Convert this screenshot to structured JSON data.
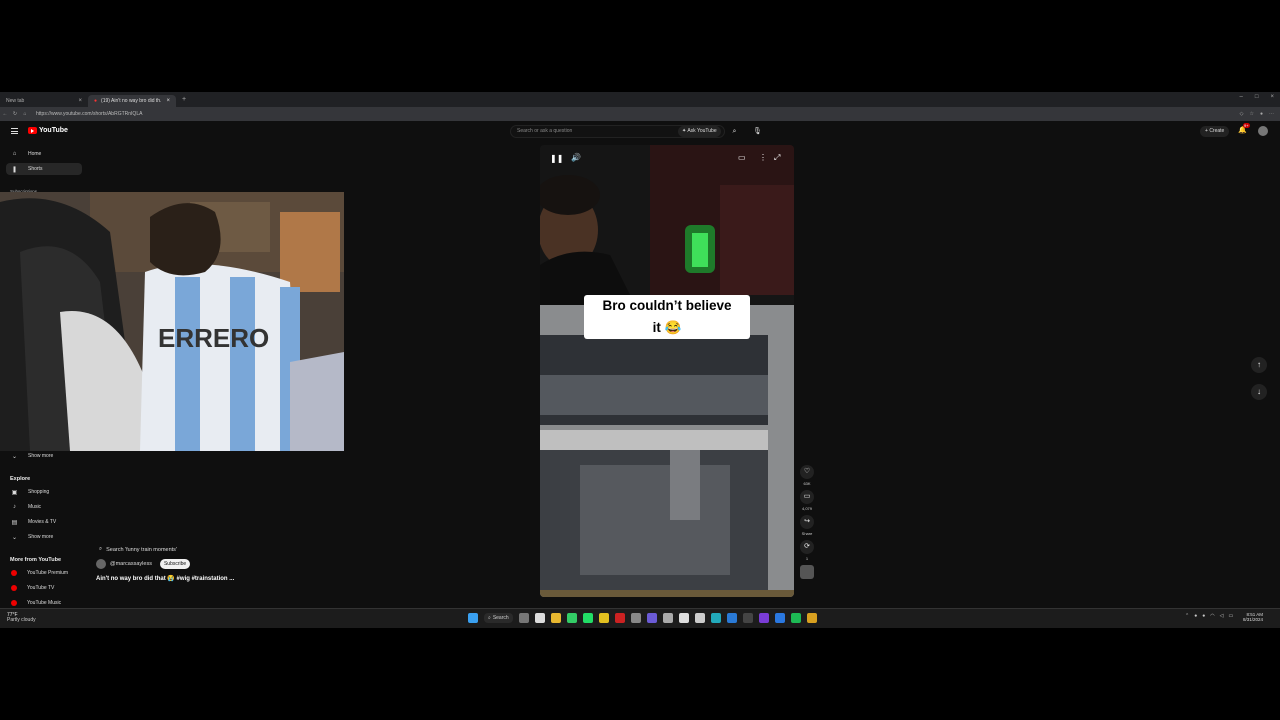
{
  "browser": {
    "tabs": [
      {
        "label": "New tab",
        "active": false
      },
      {
        "label": "(19) Ain't no way bro did th...",
        "active": true
      }
    ],
    "url": "https://www.youtube.com/shorts/AbRGTRnIQLA",
    "new_tab_glyph": "+"
  },
  "header": {
    "logo_text": "YouTube",
    "search_placeholder": "Search or ask a question",
    "ask_label": "Ask YouTube",
    "create_label": "Create",
    "notif_count": "9+"
  },
  "sidebar": {
    "top_items": [
      {
        "label": "Home",
        "icon": "home-icon"
      },
      {
        "label": "Shorts",
        "icon": "shorts-icon",
        "active": true
      }
    ],
    "subscriptions_label": "Subscriptions",
    "show_more_1": "Show more",
    "explore_header": "Explore",
    "explore_items": [
      {
        "label": "Shopping",
        "icon": "bag-icon"
      },
      {
        "label": "Music",
        "icon": "music-icon"
      },
      {
        "label": "Movies & TV",
        "icon": "film-icon"
      }
    ],
    "show_more_2": "Show more",
    "more_header": "More from YouTube",
    "more_items": [
      {
        "label": "YouTube Premium"
      },
      {
        "label": "YouTube TV"
      },
      {
        "label": "YouTube Music"
      }
    ]
  },
  "player": {
    "caption_line1": "Bro couldn’t believe",
    "caption_line2": "it 😂"
  },
  "actions": {
    "like_count": "63K",
    "comment_count": "4,079",
    "share_label": "Share",
    "remix_label": "1"
  },
  "meta": {
    "search_suggestion": "Search 'funny train moments'",
    "channel": "@marcassayless",
    "subscribe_label": "Subscribe",
    "title": "Ain't no way bro did that 😭 #wig #trainstation ..."
  },
  "taskbar": {
    "weather_temp": "77°F",
    "weather_desc": "Partly cloudy",
    "search_label": "Search",
    "time": "8:51 AM",
    "date": "8/31/2024"
  }
}
